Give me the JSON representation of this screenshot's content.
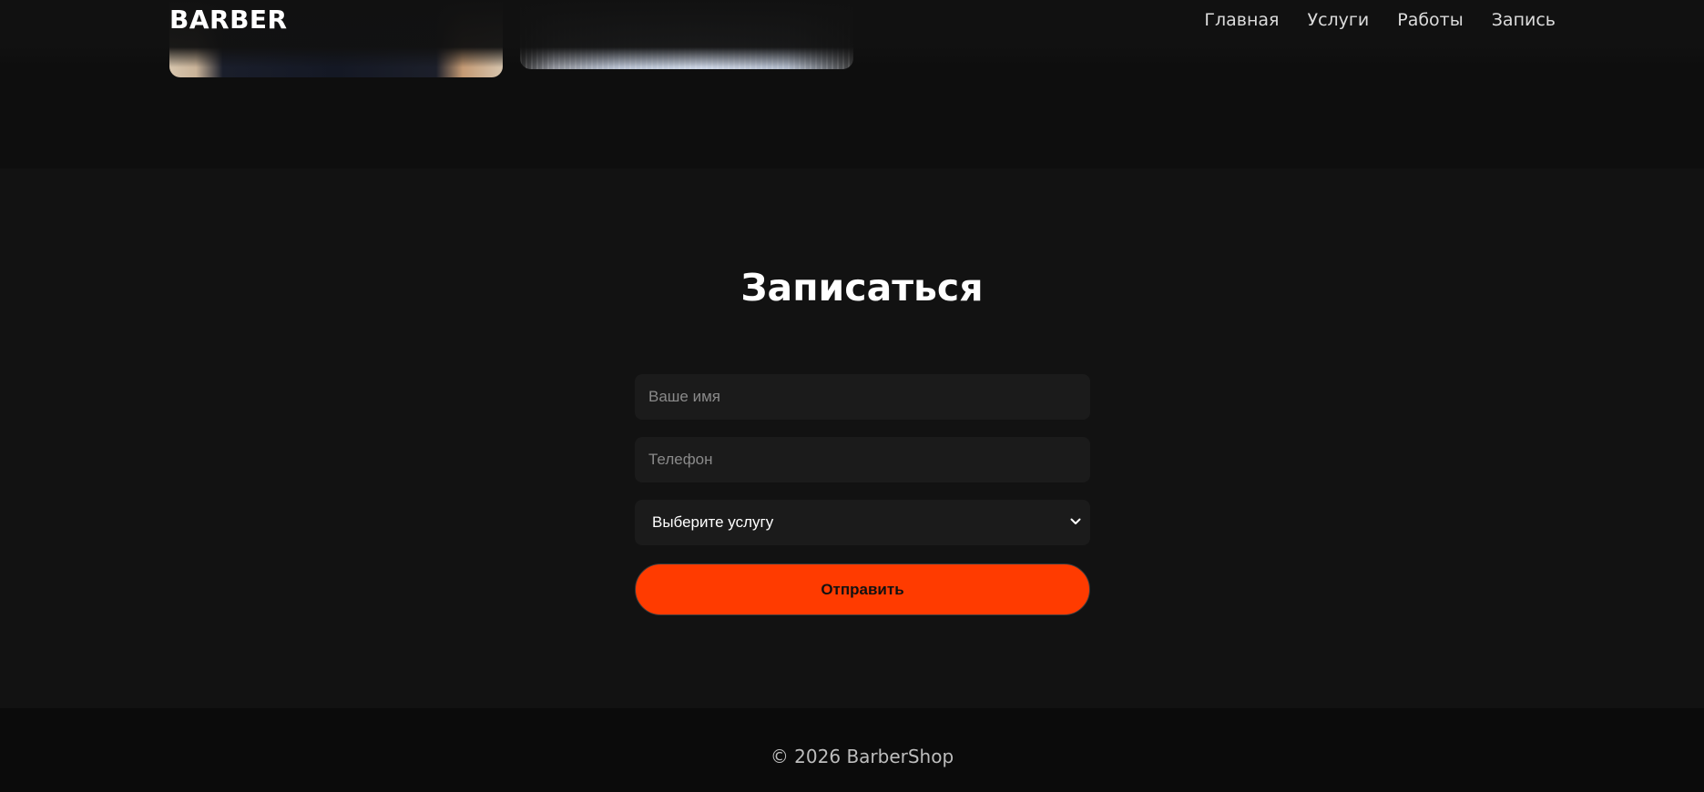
{
  "header": {
    "logo": "BARBER",
    "nav": [
      "Главная",
      "Услуги",
      "Работы",
      "Запись"
    ]
  },
  "booking": {
    "title": "Записаться",
    "name_placeholder": "Ваше имя",
    "phone_placeholder": "Телефон",
    "service_selected": "Выберите услугу",
    "submit_label": "Отправить"
  },
  "footer": {
    "copyright": "© 2026 BarberShop"
  },
  "colors": {
    "accent": "#ff3b00",
    "background": "#121212",
    "input_background": "#1b1b1b"
  }
}
